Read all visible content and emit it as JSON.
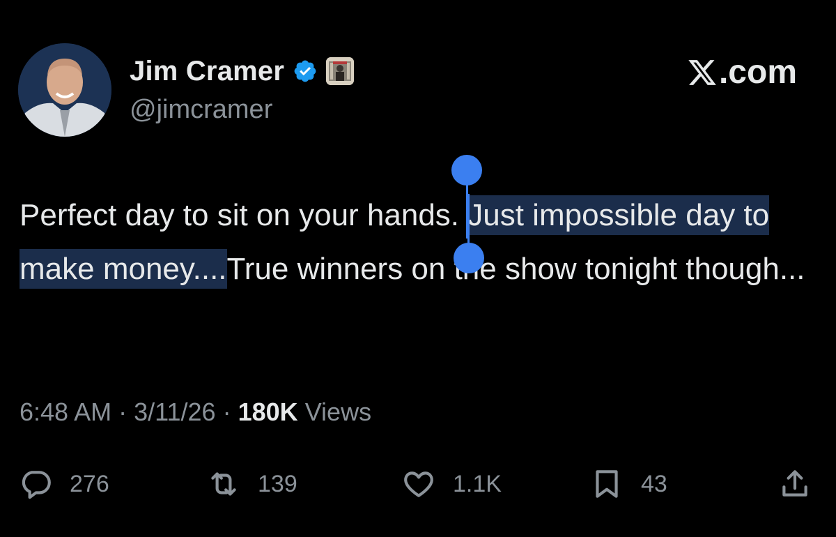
{
  "user": {
    "display_name": "Jim Cramer",
    "handle": "@jimcramer",
    "verified": true
  },
  "brand": {
    "label": ".com"
  },
  "tweet": {
    "text_before": "Perfect day to sit on your hands. ",
    "text_selected": "Just impossible day to make money....",
    "text_after": "True winners on the show tonight though..."
  },
  "meta": {
    "time": "6:48 AM",
    "separator": "·",
    "date": "3/11/26",
    "views_count": "180K",
    "views_label": "Views"
  },
  "actions": {
    "replies": "276",
    "reposts": "139",
    "likes": "1.1K",
    "bookmarks": "43"
  },
  "colors": {
    "background": "#000000",
    "text": "#e7e9ea",
    "muted": "#8b9299",
    "selection": "#1b2d4b",
    "handle_accent": "#3b7ff0",
    "verified": "#1d9bf0"
  }
}
